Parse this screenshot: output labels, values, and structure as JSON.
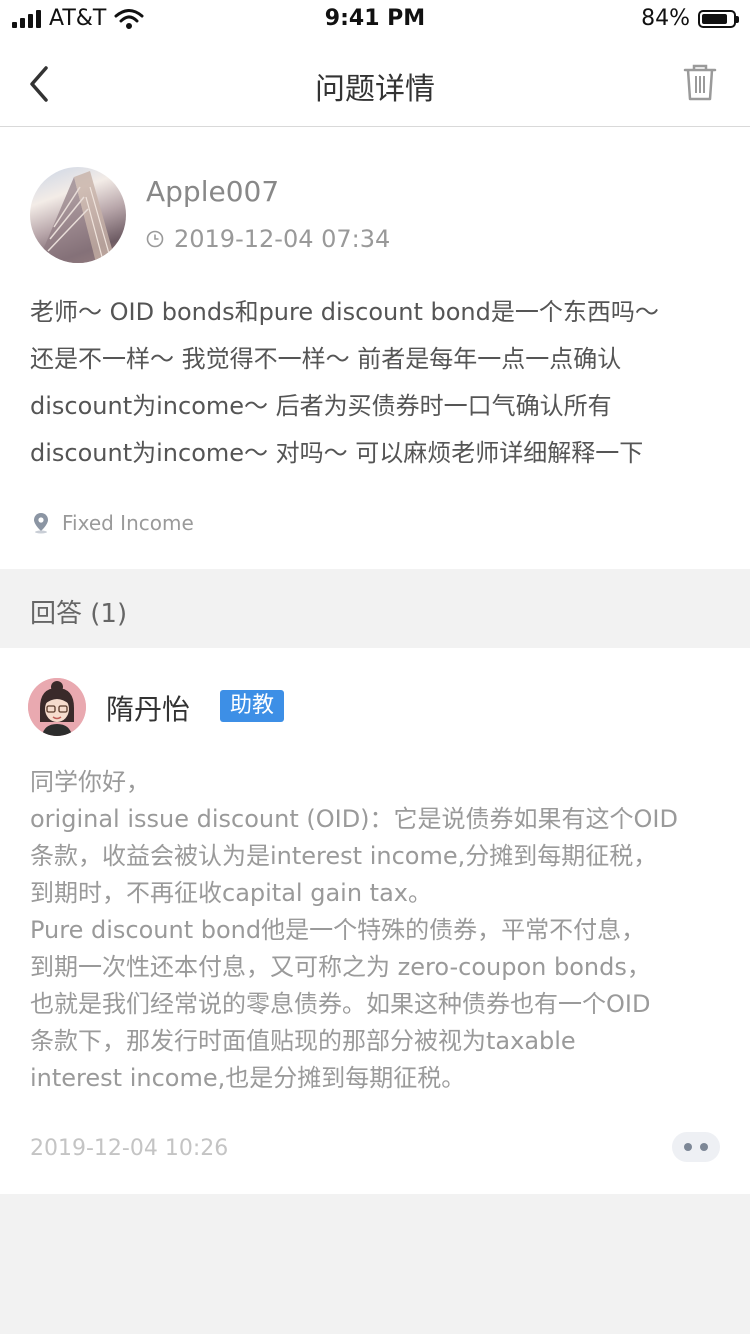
{
  "status_bar": {
    "carrier": "AT&T",
    "time": "9:41 PM",
    "battery": "84%",
    "battery_level": 0.84
  },
  "nav": {
    "title": "问题详情",
    "back_icon": "chevron-left-icon",
    "delete_icon": "trash-icon"
  },
  "question": {
    "username": "Apple007",
    "time": "2019-12-04 07:34",
    "lines": [
      "老师～ OID bonds和pure discount bond是一个东西吗～",
      "还是不一样～ 我觉得不一样～ 前者是每年一点一点确认",
      "discount为income～ 后者为买债券时一口气确认所有",
      "discount为income～ 对吗～ 可以麻烦老师详细解释一下"
    ],
    "category": "Fixed Income"
  },
  "answers_header": {
    "label": "回答 (1)"
  },
  "answer": {
    "name": "隋丹怡",
    "badge": "助教",
    "lines": [
      "同学你好，",
      "original issue discount (OID)：它是说债券如果有这个OID",
      "条款，收益会被认为是interest income,分摊到每期征税，",
      "到期时，不再征收capital gain tax。",
      "Pure discount bond他是一个特殊的债券，平常不付息，",
      "到期一次性还本付息，又可称之为 zero-coupon bonds，",
      "也就是我们经常说的零息债券。如果这种债券也有一个OID",
      "条款下，那发行时面值贴现的那部分被视为taxable",
      "interest income,也是分摊到每期征税。"
    ],
    "time": "2019-12-04 10:26"
  },
  "colors": {
    "badge": "#3d8fe6",
    "background": "#f2f2f2",
    "text_muted": "#9a9a9a"
  }
}
